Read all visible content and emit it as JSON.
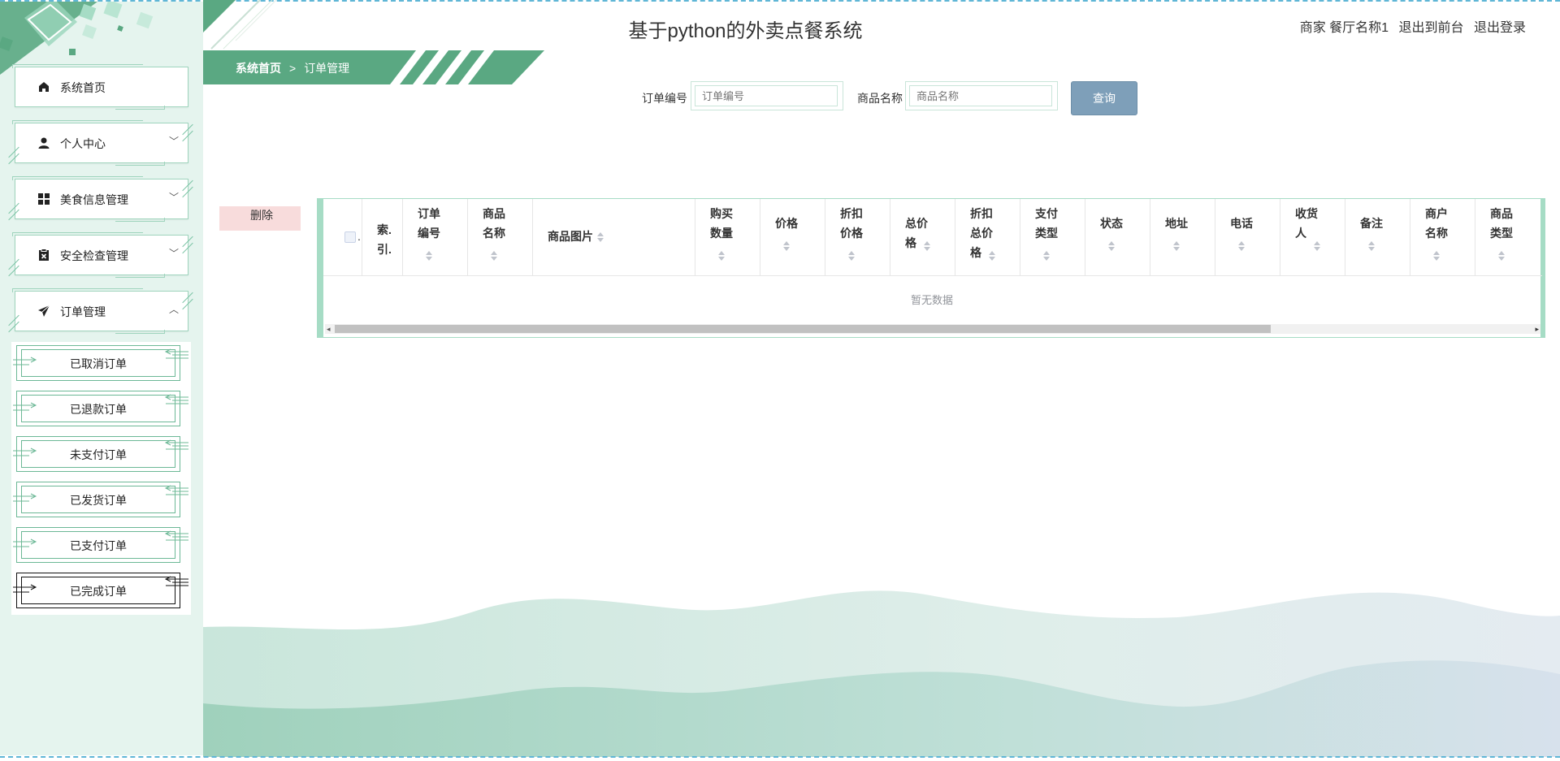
{
  "app": {
    "title": "基于python的外卖点餐系统"
  },
  "user_menu": {
    "role_name": "商家 餐厅名称1",
    "to_front": "退出到前台",
    "logout": "退出登录"
  },
  "breadcrumb": {
    "home": "系统首页",
    "separator": ">",
    "current": "订单管理"
  },
  "sidebar": {
    "items": [
      {
        "label": "系统首页",
        "icon": "home-icon"
      },
      {
        "label": "个人中心",
        "icon": "user-icon"
      },
      {
        "label": "美食信息管理",
        "icon": "grid-icon"
      },
      {
        "label": "安全检查管理",
        "icon": "clipboard-icon"
      },
      {
        "label": "订单管理",
        "icon": "send-icon"
      }
    ],
    "submenu": [
      {
        "label": "已取消订单"
      },
      {
        "label": "已退款订单"
      },
      {
        "label": "未支付订单"
      },
      {
        "label": "已发货订单"
      },
      {
        "label": "已支付订单"
      },
      {
        "label": "已完成订单"
      }
    ]
  },
  "search": {
    "order_no_label": "订单编号",
    "order_no_placeholder": "订单编号",
    "product_label": "商品名称",
    "product_placeholder": "商品名称",
    "query_button": "查询"
  },
  "actions": {
    "delete_button": "删除"
  },
  "table": {
    "index_header": "索.引.",
    "columns": [
      "订单编号",
      "商品名称",
      "商品图片",
      "购买数量",
      "价格",
      "折扣价格",
      "总价格",
      "折扣总价格",
      "支付类型",
      "状态",
      "地址",
      "电话",
      "收货人",
      "备注",
      "商户名称",
      "商品类型"
    ],
    "empty_text": "暂无数据"
  },
  "colors": {
    "accent": "#5aa882",
    "sidebar_bg": "#e5f4ee",
    "query_button": "#7e9fb9"
  }
}
